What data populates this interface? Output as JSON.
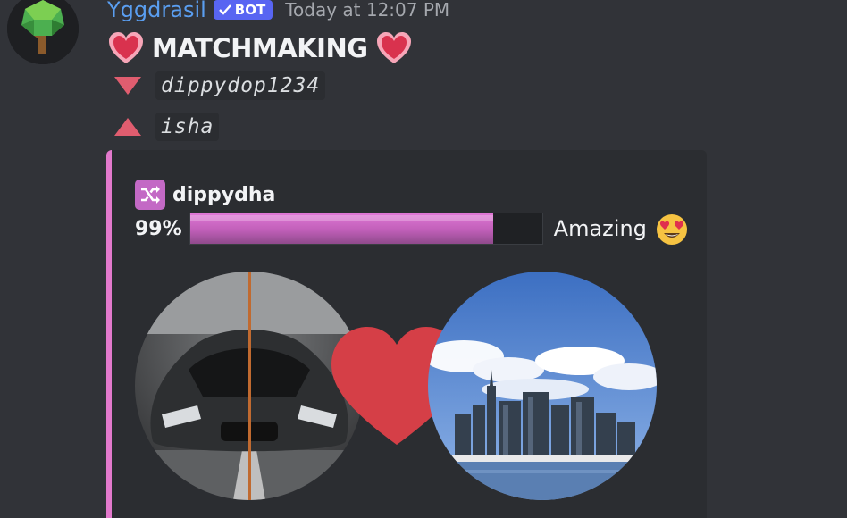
{
  "author": {
    "name": "Yggdrasil",
    "badge": "BOT",
    "timestamp": "Today at 12:07 PM",
    "avatar_icon": "tree-icon"
  },
  "message": {
    "title": "MATCHMAKING",
    "title_icon": "heart-icon",
    "user_down": "dippydop1234",
    "user_up": "isha"
  },
  "embed": {
    "accent_color": "#e279cc",
    "author_icon": "shuffle-icon",
    "author_name": "dippydha",
    "percent_label": "99%",
    "percent_value": 0.99,
    "bar_fill_fraction": 0.86,
    "rating_label": "Amazing",
    "rating_icon": "heart-eyes-emoji",
    "left_image": "car-image",
    "right_image": "city-skyline-image"
  }
}
